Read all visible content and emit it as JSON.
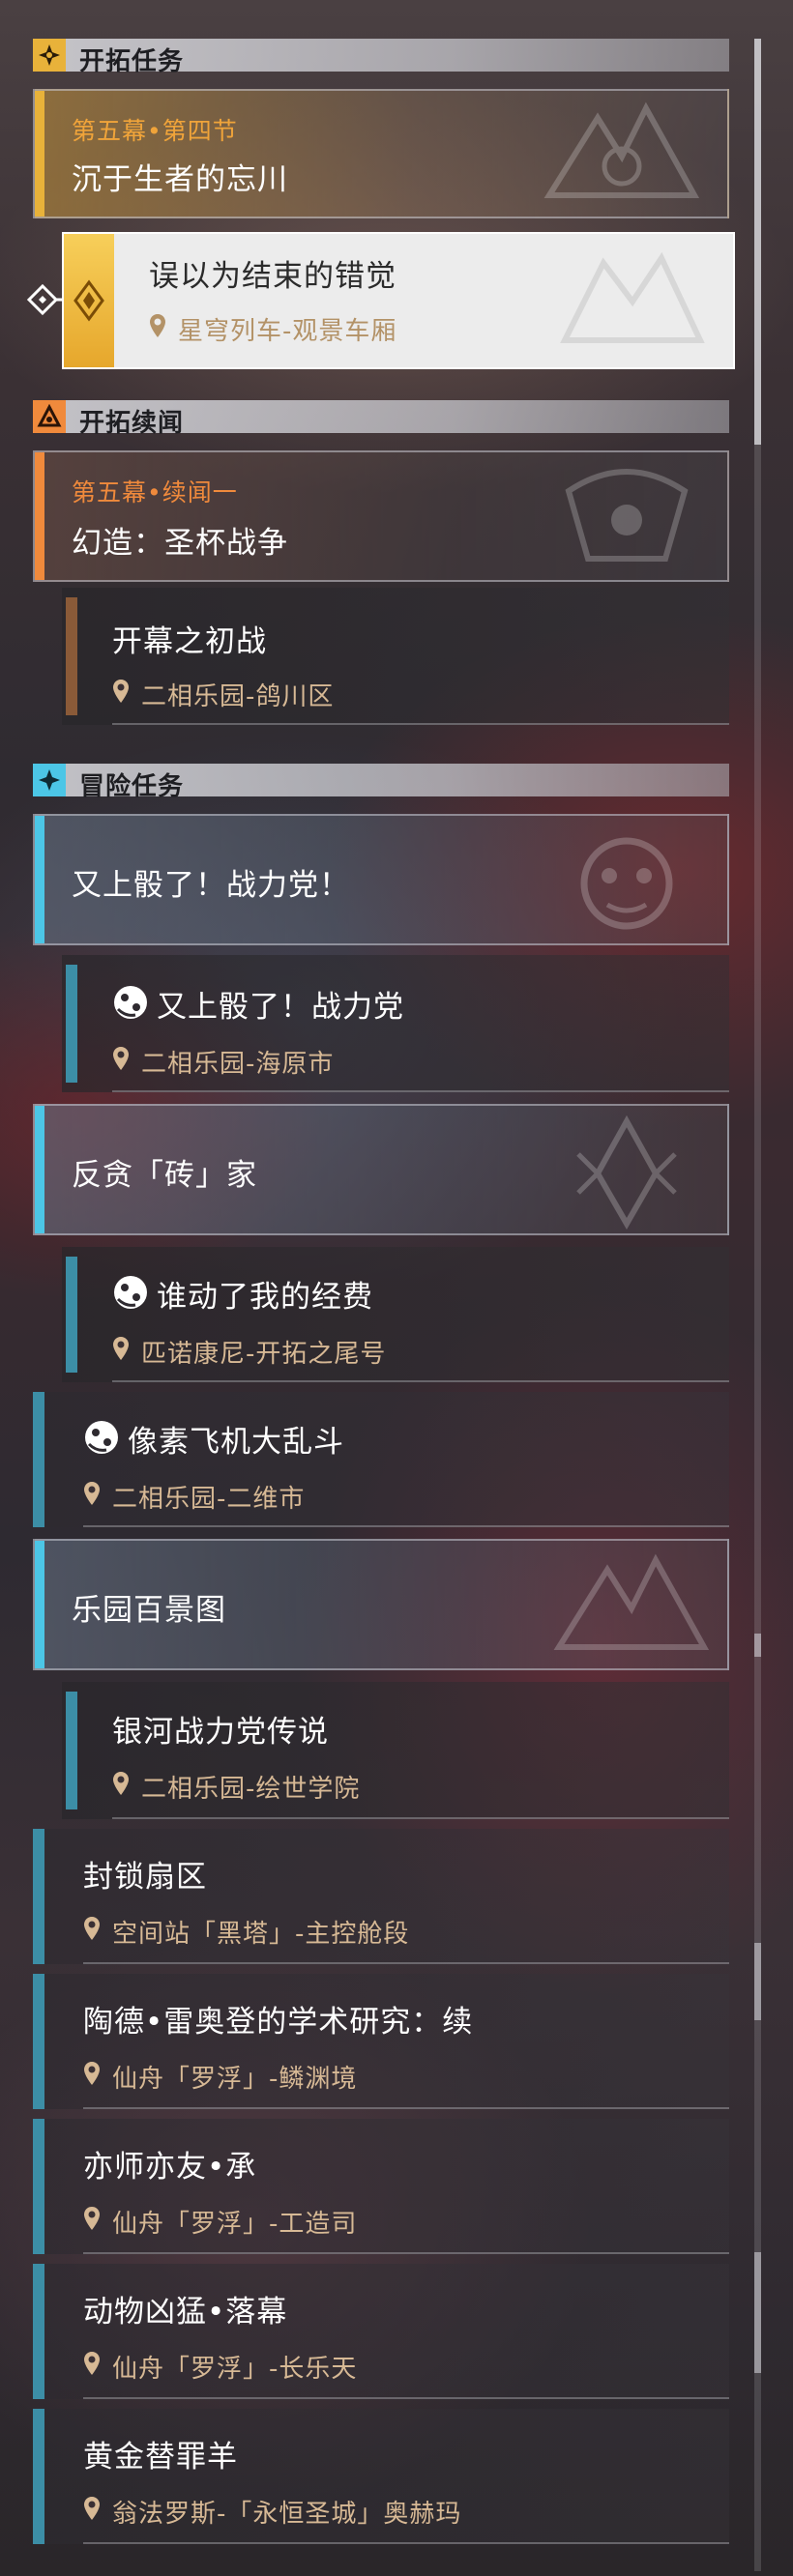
{
  "sections": {
    "trailblaze": {
      "title": "开拓任务"
    },
    "continuance": {
      "title": "开拓续闻"
    },
    "adventure": {
      "title": "冒险任务"
    }
  },
  "quests": {
    "q1": {
      "chapter": "第五幕•第四节",
      "title": "沉于生者的忘川"
    },
    "q1_sub": {
      "title": "误以为结束的错觉",
      "location": "星穹列车-观景车厢",
      "state": "selected"
    },
    "q2": {
      "chapter": "第五幕•续闻一",
      "title": "幻造：圣杯战争"
    },
    "q2_sub": {
      "title": "开幕之初战",
      "location": "二相乐园-鸽川区"
    },
    "a1": {
      "title": "又上骰了！战力党！"
    },
    "a1_sub": {
      "title": "又上骰了！战力党",
      "location": "二相乐园-海原市"
    },
    "a2": {
      "title": "反贪「砖」家"
    },
    "a2_sub": {
      "title": "谁动了我的经费",
      "location": "匹诺康尼-开拓之尾号"
    },
    "a3": {
      "title": "像素飞机大乱斗",
      "location": "二相乐园-二维市"
    },
    "a4": {
      "title": "乐园百景图"
    },
    "a4_sub": {
      "title": "银河战力党传说",
      "location": "二相乐园-绘世学院"
    },
    "a5": {
      "title": "封锁扇区",
      "location": "空间站「黑塔」-主控舱段"
    },
    "a6": {
      "title": "陶德•雷奥登的学术研究：续",
      "location": "仙舟「罗浮」-鳞渊境"
    },
    "a7": {
      "title": "亦师亦友•承",
      "location": "仙舟「罗浮」-工造司"
    },
    "a8": {
      "title": "动物凶猛•落幕",
      "location": "仙舟「罗浮」-长乐天"
    },
    "a9": {
      "title": "黄金替罪羊",
      "location": "翁法罗斯-「永恒圣城」奥赫玛"
    }
  },
  "colors": {
    "trailblaze_accent": "#e8b23a",
    "continuance_accent": "#f08a3c",
    "adventure_accent": "#4cc6e6",
    "location_text": "#d7b995",
    "chapter_text": "#f0a43a"
  },
  "icons": {
    "pin": "map-pin-icon",
    "dice": "dice-icon",
    "selected_arrow": "diamond-arrow-icon"
  }
}
